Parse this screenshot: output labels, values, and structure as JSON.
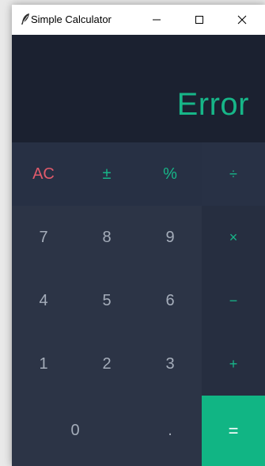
{
  "window": {
    "title": "Simple Calculator",
    "minimize_glyph": "—",
    "maximize_glyph": "☐",
    "close_glyph": "✕"
  },
  "display": {
    "value": "Error"
  },
  "keys": {
    "ac": "AC",
    "plus_minus": "±",
    "percent": "%",
    "divide": "÷",
    "seven": "7",
    "eight": "8",
    "nine": "9",
    "multiply": "×",
    "four": "4",
    "five": "5",
    "six": "6",
    "minus": "−",
    "one": "1",
    "two": "2",
    "three": "3",
    "plus": "+",
    "zero": "0",
    "dot": ".",
    "equals": "="
  },
  "colors": {
    "display_bg": "#1b2130",
    "pad_bg": "#2c3446",
    "accent_teal": "#17b688",
    "clear_red": "#e05a6b",
    "equals_bg": "#11b584"
  },
  "icons": {
    "app": "feather-icon"
  }
}
